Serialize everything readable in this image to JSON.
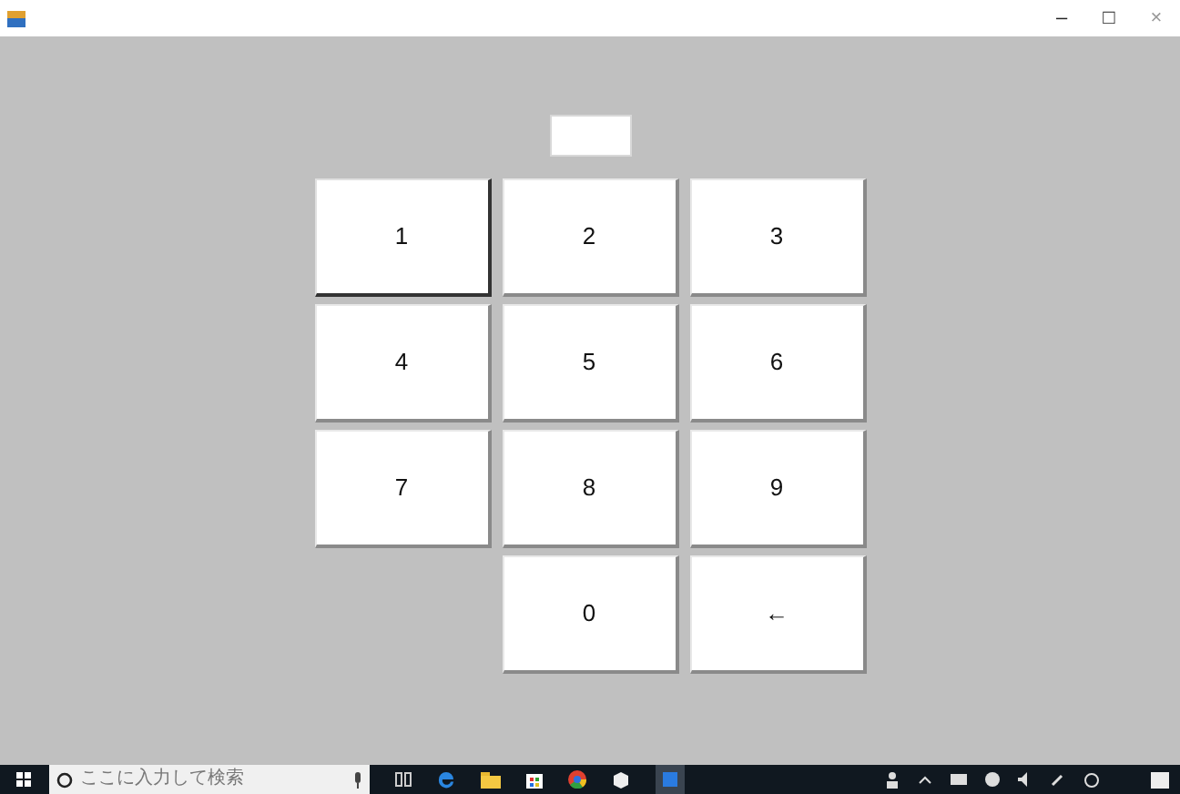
{
  "window": {
    "controls": [
      {
        "kind": "minimize",
        "label": "–"
      },
      {
        "kind": "maximize",
        "label": "□"
      },
      {
        "kind": "close",
        "label": "×"
      }
    ]
  },
  "keypad": {
    "rows": [
      {
        "keys": [
          {
            "label": "1",
            "focused": true
          },
          {
            "label": "2",
            "focused": false
          },
          {
            "label": "3",
            "focused": false
          }
        ]
      },
      {
        "keys": [
          {
            "label": "4",
            "focused": false
          },
          {
            "label": "5",
            "focused": false
          },
          {
            "label": "6",
            "focused": false
          }
        ]
      },
      {
        "keys": [
          {
            "label": "7",
            "focused": false
          },
          {
            "label": "8",
            "focused": false
          },
          {
            "label": "9",
            "focused": false
          }
        ]
      },
      {
        "keys": [
          {
            "label": "0",
            "focused": false
          },
          {
            "label": "←",
            "focused": false
          }
        ]
      }
    ]
  },
  "taskbar": {
    "search": {
      "placeholder": "ここに入力して検索"
    }
  }
}
